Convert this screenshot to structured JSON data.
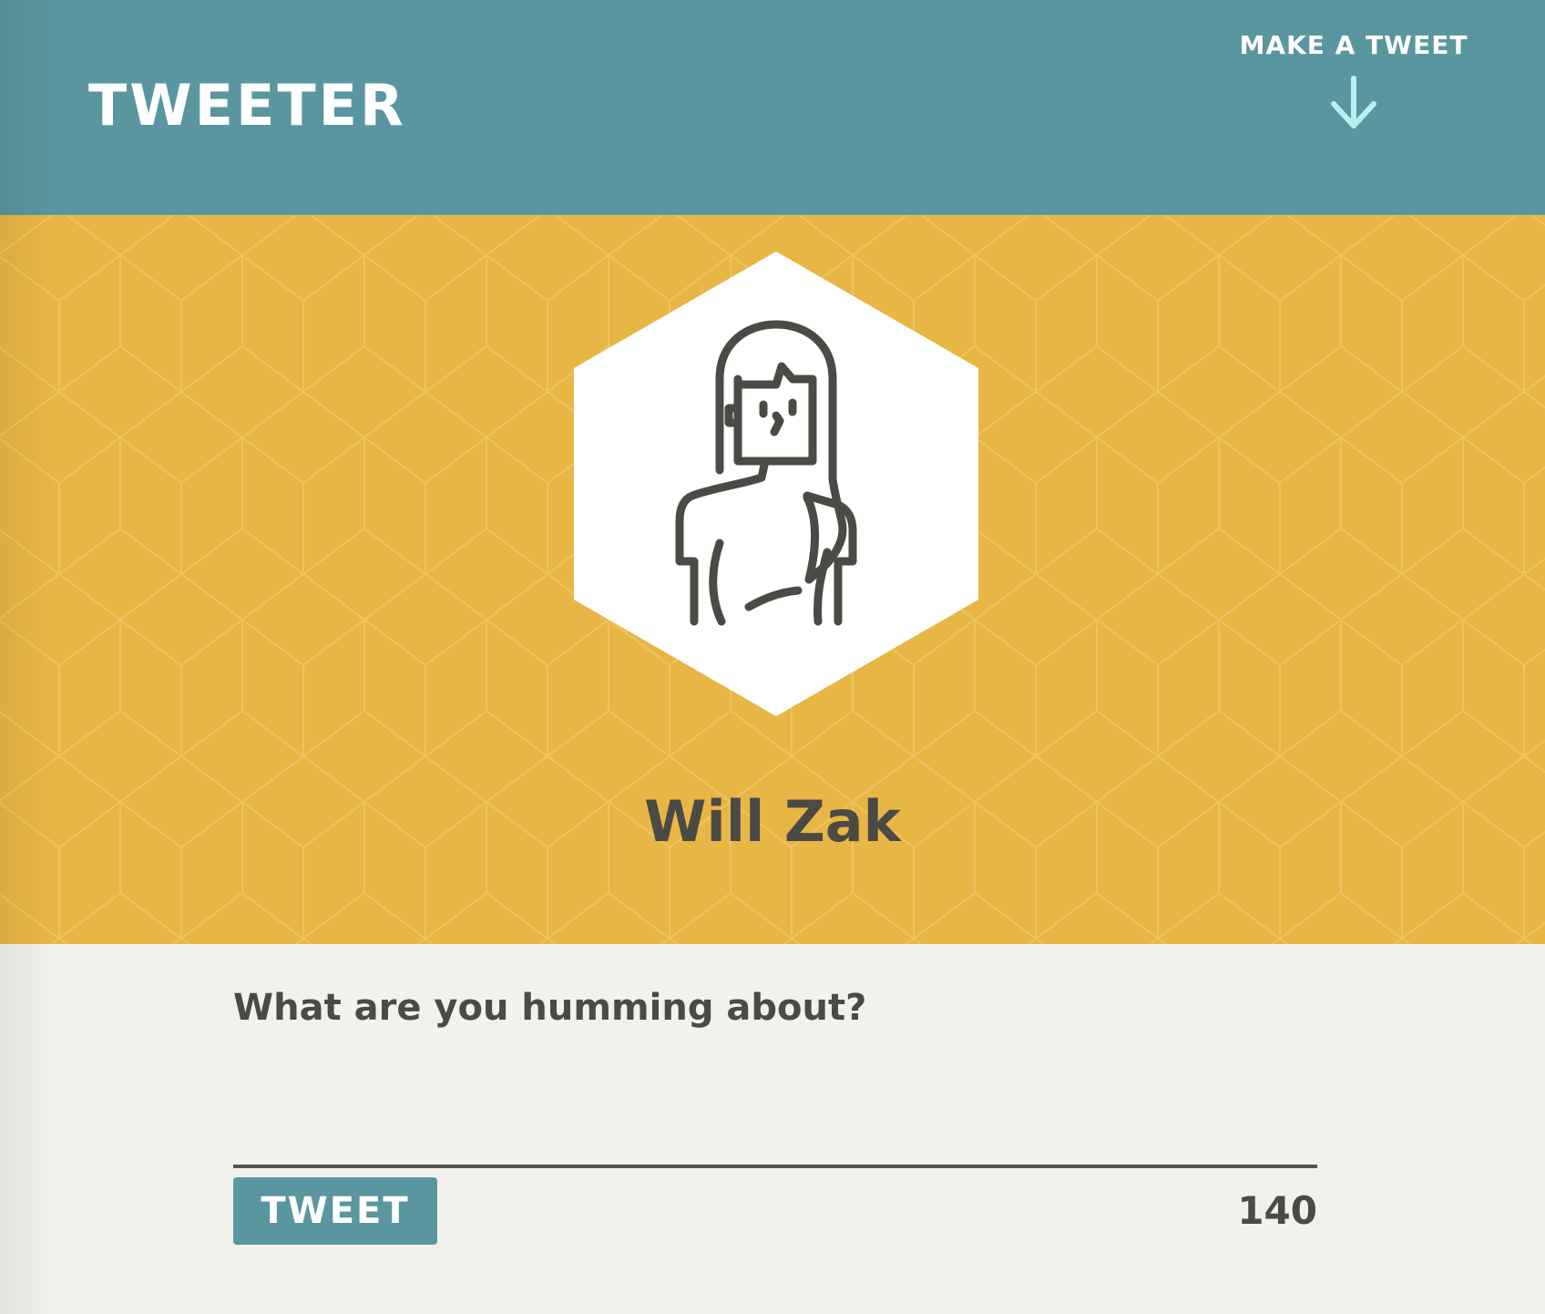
{
  "header": {
    "brand": "TWEETER",
    "make_tweet_label": "MAKE A TWEET",
    "make_tweet_icon": "arrow-down-icon"
  },
  "profile": {
    "name": "Will Zak",
    "avatar_icon": "person-avatar-icon"
  },
  "compose": {
    "prompt": "What are you humming about?",
    "input_value": "",
    "button_label": "TWEET",
    "char_count": "140"
  },
  "colors": {
    "header_bg": "#5a969f",
    "hero_bg": "#e8b645",
    "compose_bg": "#f2f1ed",
    "text_dark": "#4b4a45",
    "arrow": "#b8f0f2",
    "white": "#ffffff"
  }
}
